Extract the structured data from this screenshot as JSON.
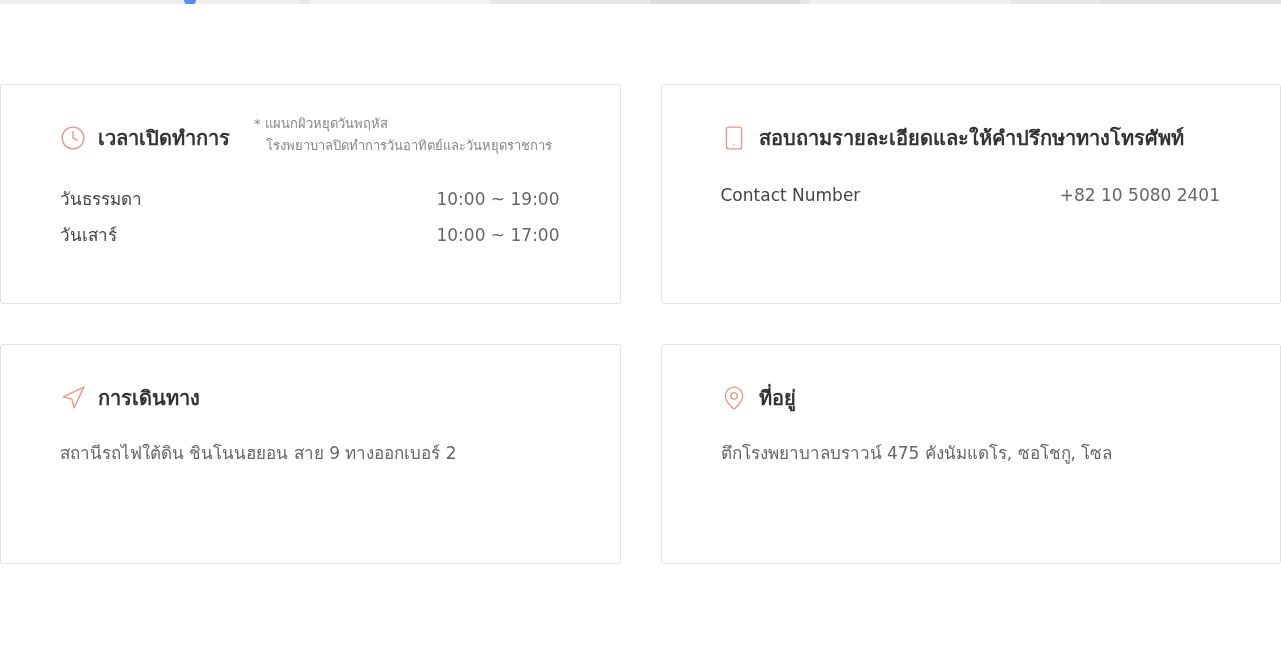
{
  "cards": [
    {
      "kind": "rows",
      "title": "เวลาเปิดทำการ",
      "note": [
        "* แผนกผิวหยุดวันพฤหัส",
        "โรงพยาบาลปิดทำการวันอาทิตย์และวันหยุดราชการ"
      ],
      "rows": [
        {
          "label": "วันธรรมดา",
          "value": "10:00 ~ 19:00"
        },
        {
          "label": "วันเสาร์",
          "value": "10:00 ~ 17:00"
        }
      ]
    },
    {
      "kind": "rows",
      "title": "สอบถามรายละเอียดและให้คำปรึกษาทางโทรศัพท์",
      "rows": [
        {
          "label": "Contact Number",
          "value": "+82 10 5080 2401"
        }
      ]
    },
    {
      "kind": "text",
      "title": "การเดินทาง",
      "text": "สถานีรถไฟใต้ดิน ชินโนนฮยอน สาย 9 ทางออกเบอร์ 2"
    },
    {
      "kind": "text",
      "title": "ที่อยู่",
      "text": "ตึกโรงพยาบาลบราวน์ 475 คังนัมแดโร, ซอโชกู, โซล"
    }
  ]
}
